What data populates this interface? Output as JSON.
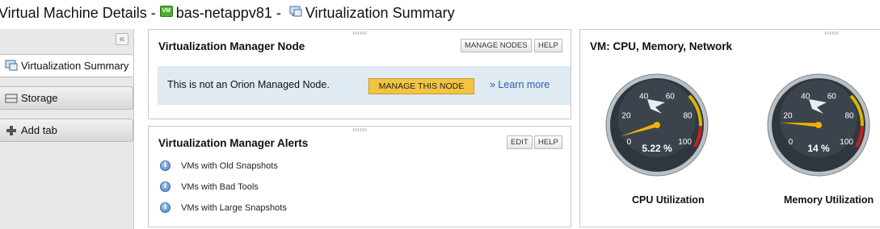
{
  "header": {
    "prefix": "Virtual Machine Details - ",
    "vm_badge": "VM",
    "node_name": "bas-netappv81",
    "separator": " - ",
    "view_name": "Virtualization Summary",
    "icons": [
      "vm-icon",
      "monitor-icon"
    ]
  },
  "sidebar": {
    "collapse_symbol": "«",
    "tabs": [
      {
        "label": "Virtualization Summary",
        "icon": "monitor-icon",
        "active": true
      },
      {
        "label": "Storage",
        "icon": "storage-icon",
        "active": false
      },
      {
        "label": "Add tab",
        "icon": "plus-icon",
        "active": false
      }
    ]
  },
  "vman_node": {
    "title": "Virtualization Manager Node",
    "manage_nodes_label": "MANAGE NODES",
    "help_label": "HELP",
    "notice_text": "This is not an Orion Managed Node.",
    "manage_this_node_label": "MANAGE THIS NODE",
    "learn_more_label": "» Learn more"
  },
  "vman_alerts": {
    "title": "Virtualization Manager Alerts",
    "edit_label": "EDIT",
    "help_label": "HELP",
    "items": [
      "VMs with Old Snapshots",
      "VMs with Bad Tools",
      "VMs with Large Snapshots"
    ]
  },
  "vm_resources": {
    "title": "VM: CPU, Memory, Network",
    "gauges": [
      {
        "name": "CPU Utilization",
        "value": 5.22,
        "value_text": "5.22 %",
        "ticks": [
          "0",
          "20",
          "40",
          "60",
          "80",
          "100"
        ]
      },
      {
        "name": "Memory Utilization",
        "value": 14,
        "value_text": "14 %",
        "ticks": [
          "0",
          "20",
          "40",
          "60",
          "80",
          "100"
        ]
      }
    ],
    "colors": {
      "needle": "#f5b200",
      "warning": "#d8b800",
      "critical": "#c62020"
    }
  }
}
